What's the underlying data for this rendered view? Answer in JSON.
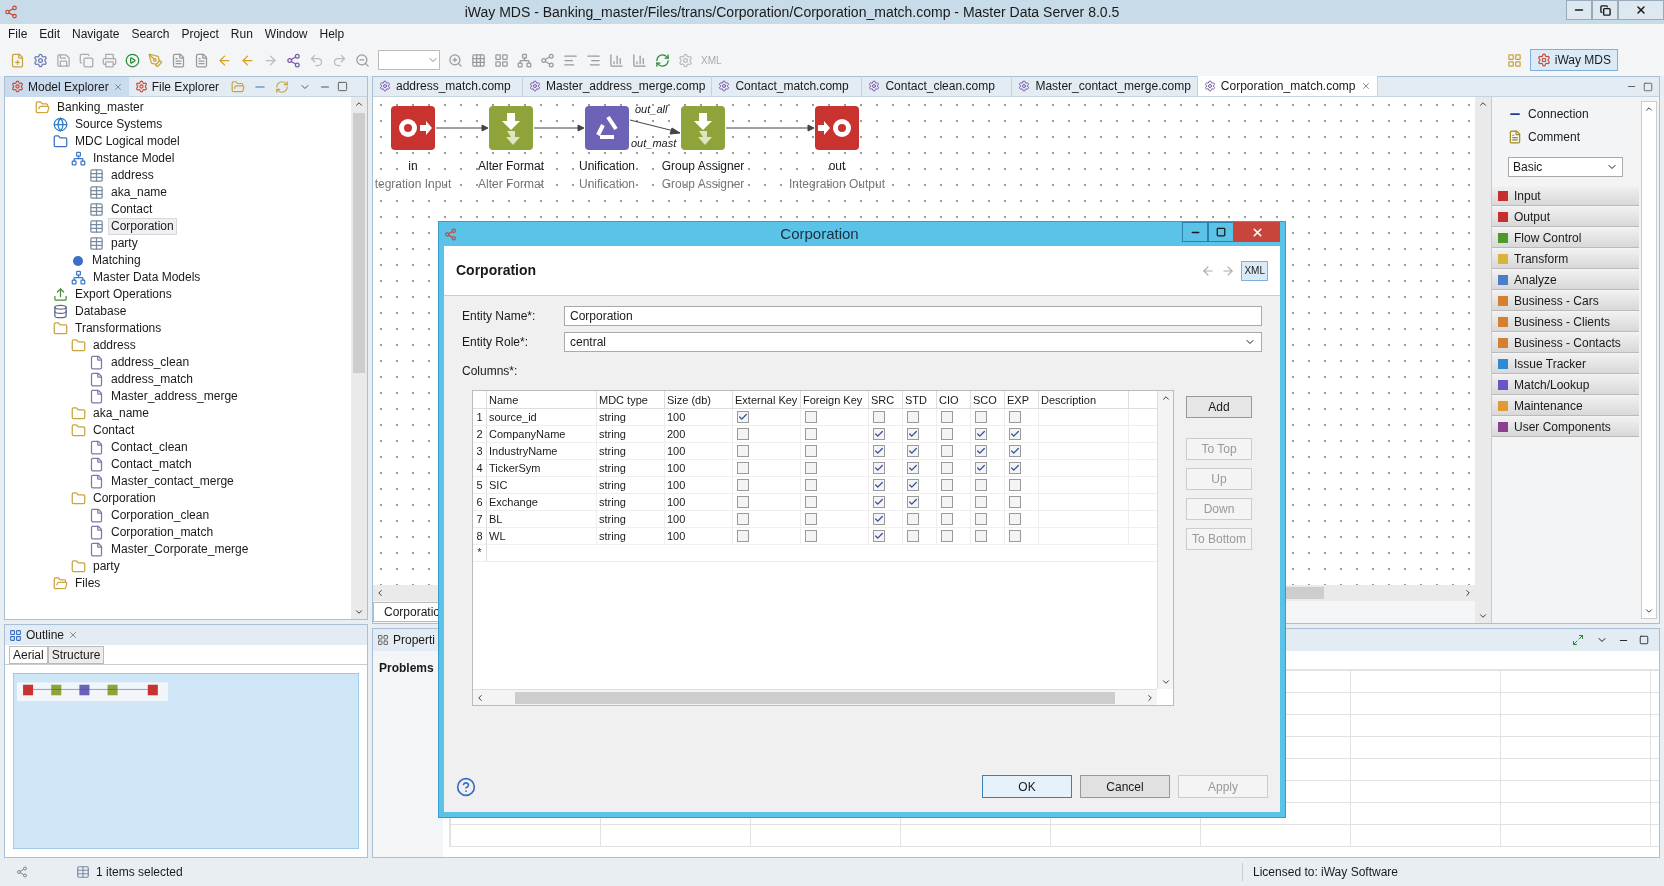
{
  "window": {
    "title": "iWay MDS - Banking_master/Files/trans/Corporation/Corporation_match.comp - Master Data Server 8.0.5"
  },
  "menu": [
    "File",
    "Edit",
    "Navigate",
    "Search",
    "Project",
    "Run",
    "Window",
    "Help"
  ],
  "toolbar": {
    "xml_label": "XML",
    "perspective": "iWay MDS"
  },
  "left_tabs": [
    {
      "label": "Model Explorer",
      "selected": true
    },
    {
      "label": "File Explorer",
      "selected": false
    }
  ],
  "tree": [
    {
      "label": "Banking_master",
      "kind": "open-folder",
      "selected": false,
      "children": [
        {
          "label": "Source Systems",
          "kind": "globe",
          "selected": false
        },
        {
          "label": "MDC Logical model",
          "kind": "model",
          "selected": false,
          "children": [
            {
              "label": "Instance Model",
              "kind": "hierarchy",
              "selected": false,
              "children": [
                {
                  "label": "address",
                  "kind": "table",
                  "selected": false
                },
                {
                  "label": "aka_name",
                  "kind": "table",
                  "selected": false
                },
                {
                  "label": "Contact",
                  "kind": "table",
                  "selected": false
                },
                {
                  "label": "Corporation",
                  "kind": "table",
                  "selected": true
                },
                {
                  "label": "party",
                  "kind": "table",
                  "selected": false
                }
              ]
            },
            {
              "label": "Matching",
              "kind": "dot",
              "selected": false
            },
            {
              "label": "Master Data Models",
              "kind": "hierarchy",
              "selected": false
            }
          ]
        },
        {
          "label": "Export Operations",
          "kind": "export",
          "selected": false
        },
        {
          "label": "Database",
          "kind": "database",
          "selected": false
        },
        {
          "label": "Transformations",
          "kind": "gear-folder",
          "selected": false,
          "children": [
            {
              "label": "address",
              "kind": "gear-folder",
              "selected": false,
              "children": [
                {
                  "label": "address_clean",
                  "kind": "file",
                  "selected": false
                },
                {
                  "label": "address_match",
                  "kind": "file",
                  "selected": false
                },
                {
                  "label": "Master_address_merge",
                  "kind": "file",
                  "selected": false
                }
              ]
            },
            {
              "label": "aka_name",
              "kind": "gear-folder",
              "selected": false
            },
            {
              "label": "Contact",
              "kind": "gear-folder",
              "selected": false,
              "children": [
                {
                  "label": "Contact_clean",
                  "kind": "file",
                  "selected": false
                },
                {
                  "label": "Contact_match",
                  "kind": "file",
                  "selected": false
                },
                {
                  "label": "Master_contact_merge",
                  "kind": "file",
                  "selected": false
                }
              ]
            },
            {
              "label": "Corporation",
              "kind": "gear-folder",
              "selected": false,
              "children": [
                {
                  "label": "Corporation_clean",
                  "kind": "file",
                  "selected": false
                },
                {
                  "label": "Corporation_match",
                  "kind": "file",
                  "selected": false
                },
                {
                  "label": "Master_Corporate_merge",
                  "kind": "file",
                  "selected": false
                }
              ]
            },
            {
              "label": "party",
              "kind": "gear-folder",
              "selected": false
            }
          ]
        },
        {
          "label": "Files",
          "kind": "open-folder",
          "selected": false
        }
      ]
    }
  ],
  "editor_tabs": [
    {
      "label": "address_match.comp",
      "selected": false
    },
    {
      "label": "Master_address_merge.comp",
      "selected": false
    },
    {
      "label": "Contact_match.comp",
      "selected": false
    },
    {
      "label": "Contact_clean.comp",
      "selected": false
    },
    {
      "label": "Master_contact_merge.comp",
      "selected": false
    },
    {
      "label": "Corporation_match.comp",
      "selected": true
    }
  ],
  "canvas": {
    "nodes": [
      {
        "name": "in",
        "type": "tegration Input",
        "kind": "input"
      },
      {
        "name": "Alter Format",
        "type": "Alter Format",
        "kind": "transform"
      },
      {
        "name": "Unification",
        "type": "Unification",
        "kind": "match"
      },
      {
        "name": "Group Assigner",
        "type": "Group Assigner",
        "kind": "group"
      },
      {
        "name": "out",
        "type": "Integration Output",
        "kind": "output"
      }
    ],
    "edge_labels": [
      "out_all",
      "out_mast"
    ]
  },
  "palette": {
    "tools": [
      "Connection",
      "Comment"
    ],
    "filter": "Basic",
    "drawers": [
      {
        "label": "Input",
        "color": "#c62f2f"
      },
      {
        "label": "Output",
        "color": "#c62f2f"
      },
      {
        "label": "Flow Control",
        "color": "#4c9a2a"
      },
      {
        "label": "Transform",
        "color": "#d8b43a"
      },
      {
        "label": "Analyze",
        "color": "#4a7fc8"
      },
      {
        "label": "Business - Cars",
        "color": "#d4802f"
      },
      {
        "label": "Business - Clients",
        "color": "#d4802f"
      },
      {
        "label": "Business - Contacts",
        "color": "#d4802f"
      },
      {
        "label": "Issue Tracker",
        "color": "#2f8ad4"
      },
      {
        "label": "Match/Lookup",
        "color": "#6a55c4"
      },
      {
        "label": "Maintenance",
        "color": "#e09a2f"
      },
      {
        "label": "User Components",
        "color": "#8a3f8f"
      }
    ]
  },
  "editor_bottom_tab": "Corporatio",
  "outline": {
    "title": "Outline",
    "tabs": [
      {
        "label": "Aerial",
        "selected": true
      },
      {
        "label": "Structure",
        "selected": false
      }
    ]
  },
  "bottom_tabs": [
    "Properti",
    "Problems"
  ],
  "status_bar": {
    "selection": "1 items selected",
    "license": "Licensed to: iWay Software"
  },
  "dialog": {
    "title": "Corporation",
    "heading": "Corporation",
    "xml": "XML",
    "entity_name_label": "Entity Name*:",
    "entity_name": "Corporation",
    "entity_role_label": "Entity Role*:",
    "entity_role": "central",
    "columns_label": "Columns*:",
    "table": {
      "columns": [
        "Name",
        "MDC type",
        "Size (db)",
        "External Key",
        "Foreign Key",
        "SRC",
        "STD",
        "CIO",
        "SCO",
        "EXP",
        "Description"
      ],
      "rows": [
        {
          "index": "1",
          "name": "source_id",
          "type": "string",
          "size": "100",
          "flags": [
            true,
            false,
            false,
            false,
            false,
            false,
            false
          ]
        },
        {
          "index": "2",
          "name": "CompanyName",
          "type": "string",
          "size": "200",
          "flags": [
            false,
            false,
            true,
            true,
            false,
            true,
            true
          ]
        },
        {
          "index": "3",
          "name": "IndustryName",
          "type": "string",
          "size": "100",
          "flags": [
            false,
            false,
            true,
            true,
            false,
            true,
            true
          ]
        },
        {
          "index": "4",
          "name": "TickerSym",
          "type": "string",
          "size": "100",
          "flags": [
            false,
            false,
            true,
            true,
            false,
            true,
            true
          ]
        },
        {
          "index": "5",
          "name": "SIC",
          "type": "string",
          "size": "100",
          "flags": [
            false,
            false,
            true,
            true,
            false,
            false,
            false
          ]
        },
        {
          "index": "6",
          "name": "Exchange",
          "type": "string",
          "size": "100",
          "flags": [
            false,
            false,
            true,
            true,
            false,
            false,
            false
          ]
        },
        {
          "index": "7",
          "name": "BL",
          "type": "string",
          "size": "100",
          "flags": [
            false,
            false,
            true,
            false,
            false,
            false,
            false
          ]
        },
        {
          "index": "8",
          "name": "WL",
          "type": "string",
          "size": "100",
          "flags": [
            false,
            false,
            true,
            false,
            false,
            false,
            false
          ]
        }
      ],
      "new_row_marker": "*"
    },
    "side_buttons": [
      {
        "label": "Add",
        "disabled": false
      },
      {
        "label": "To Top",
        "disabled": true
      },
      {
        "label": "Up",
        "disabled": true
      },
      {
        "label": "Down",
        "disabled": true
      },
      {
        "label": "To Bottom",
        "disabled": true
      }
    ],
    "buttons": [
      {
        "label": "OK",
        "disabled": false,
        "selected": true
      },
      {
        "label": "Cancel",
        "disabled": false,
        "selected": false
      },
      {
        "label": "Apply",
        "disabled": true,
        "selected": false
      }
    ]
  }
}
